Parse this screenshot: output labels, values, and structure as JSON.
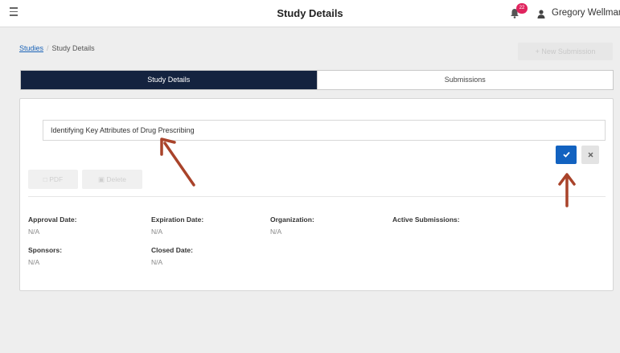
{
  "header": {
    "title": "Study Details",
    "notification_count": "22",
    "user_name": "Gregory Wellman"
  },
  "breadcrumb": {
    "link": "Studies",
    "separator": "/",
    "current": "Study Details"
  },
  "actions": {
    "new_submission": "+ New Submission"
  },
  "tabs": [
    {
      "label": "Study Details",
      "active": true
    },
    {
      "label": "Submissions",
      "active": false
    }
  ],
  "study": {
    "title_value": "Identifying Key Attributes of Drug Prescribing",
    "confirm_icon": "checkmark-icon",
    "cancel_icon": "x-icon",
    "pdf_label": "PDF",
    "delete_label": "Delete"
  },
  "fields": {
    "approval_date": {
      "label": "Approval Date:",
      "value": "N/A"
    },
    "expiration_date": {
      "label": "Expiration Date:",
      "value": "N/A"
    },
    "organization": {
      "label": "Organization:",
      "value": "N/A"
    },
    "active_submissions": {
      "label": "Active Submissions:",
      "value": ""
    },
    "sponsors": {
      "label": "Sponsors:",
      "value": "N/A"
    },
    "closed_date": {
      "label": "Closed Date:",
      "value": "N/A"
    }
  },
  "colors": {
    "active_tab": "#14233f",
    "confirm_button": "#1262c0",
    "badge": "#e0245e",
    "annotation_arrow": "#a9432a"
  }
}
